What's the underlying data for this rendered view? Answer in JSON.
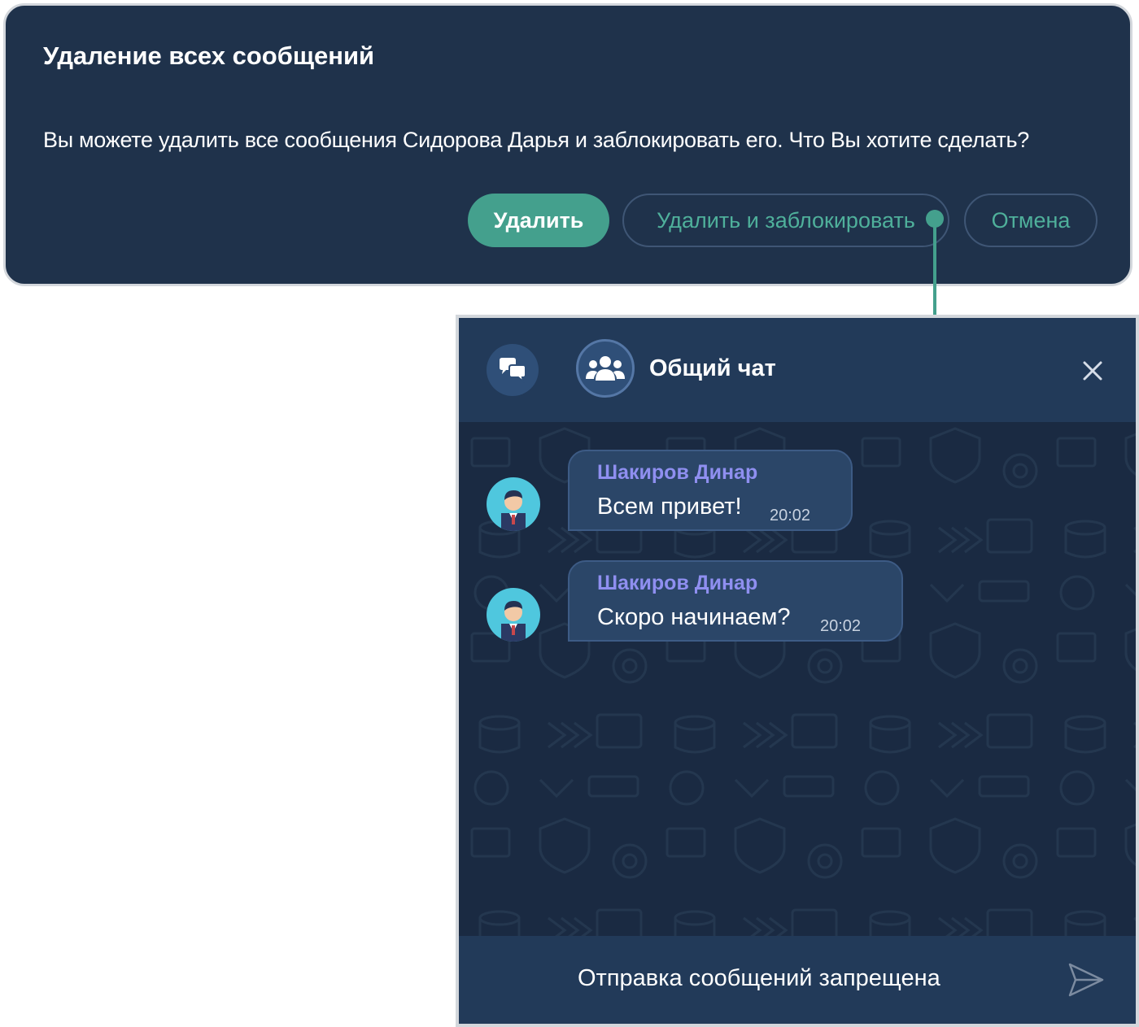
{
  "dialog": {
    "title": "Удаление всех сообщений",
    "message": "Вы можете удалить все сообщения Сидорова Дарья и заблокировать его. Что Вы хотите сделать?",
    "buttons": {
      "delete": "Удалить",
      "delete_and_block": "Удалить и заблокировать",
      "cancel": "Отмена"
    }
  },
  "chat": {
    "header": {
      "title": "Общий чат",
      "chats_icon": "chat-bubbles-icon",
      "group_icon": "users-group-icon",
      "close_icon": "close-icon"
    },
    "messages": [
      {
        "sender": "Шакиров Динар",
        "text": "Всем привет!",
        "time": "20:02"
      },
      {
        "sender": "Шакиров Динар",
        "text": "Скоро начинаем?",
        "time": "20:02"
      }
    ],
    "footer": {
      "status": "Отправка сообщений запрещена",
      "send_icon": "send-icon"
    }
  },
  "colors": {
    "panel": "#1f324b",
    "accent": "#44a08d",
    "sender_name": "#8f8ff0",
    "bubble": "#2b4668"
  }
}
